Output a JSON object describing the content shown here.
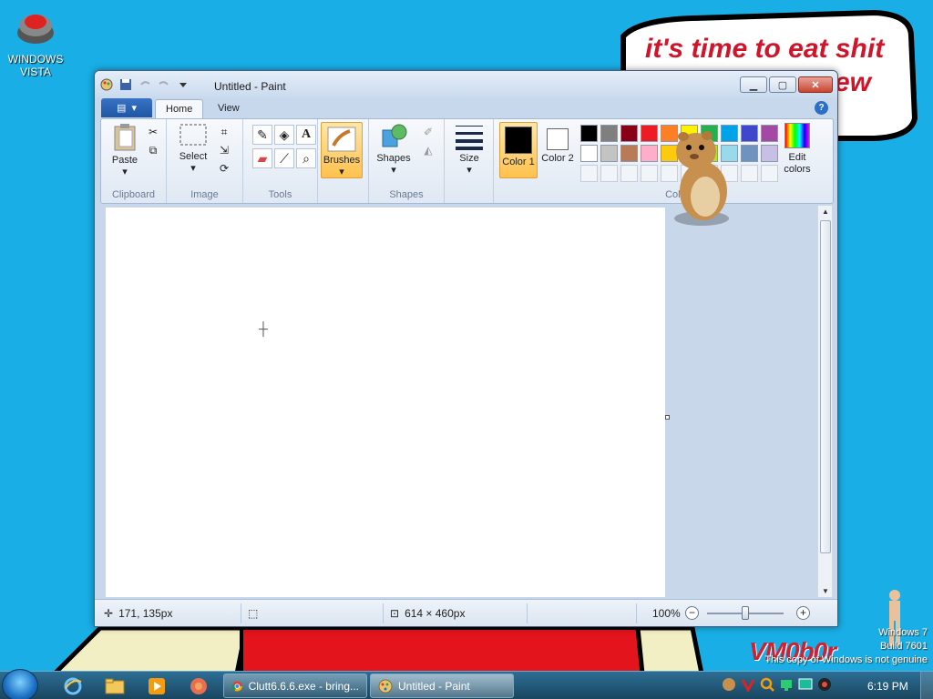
{
  "desktop": {
    "icon_label": "WINDOWS VISTA",
    "bubble_line1": "it's time to eat shit",
    "bubble_line2": "ew",
    "watermark_line1": "Windows 7",
    "watermark_line2": "Build 7601",
    "watermark_line3": "This copy of Windows is not genuine",
    "logo_text": "VM0b0r"
  },
  "window": {
    "title": "Untitled - Paint",
    "tabs": {
      "home": "Home",
      "view": "View"
    },
    "help": "?"
  },
  "ribbon": {
    "groups": {
      "clipboard": "Clipboard",
      "image": "Image",
      "tools": "Tools",
      "shapes": "Shapes",
      "colors": "Colors"
    },
    "paste": "Paste",
    "select": "Select",
    "brushes": "Brushes",
    "shapes": "Shapes",
    "size": "Size",
    "color1": "Color 1",
    "color2": "Color 2",
    "edit_colors": "Edit colors",
    "palette_row1": [
      "#000000",
      "#7f7f7f",
      "#880015",
      "#ed1c24",
      "#ff7f27",
      "#fff200",
      "#22b14c",
      "#00a2e8",
      "#3f48cc",
      "#a349a4"
    ],
    "palette_row2": [
      "#ffffff",
      "#c3c3c3",
      "#b97a57",
      "#ffaec9",
      "#ffc90e",
      "#efe4b0",
      "#b5e61d",
      "#99d9ea",
      "#7092be",
      "#c8bfe7"
    ],
    "color1_value": "#000000",
    "color2_value": "#ffffff"
  },
  "status": {
    "cursor_pos": "171, 135px",
    "canvas_size": "614 × 460px",
    "zoom": "100%"
  },
  "taskbar": {
    "btn_chrome": "Clutt6.6.6.exe - bring...",
    "btn_paint": "Untitled - Paint",
    "clock": "6:19 PM"
  }
}
